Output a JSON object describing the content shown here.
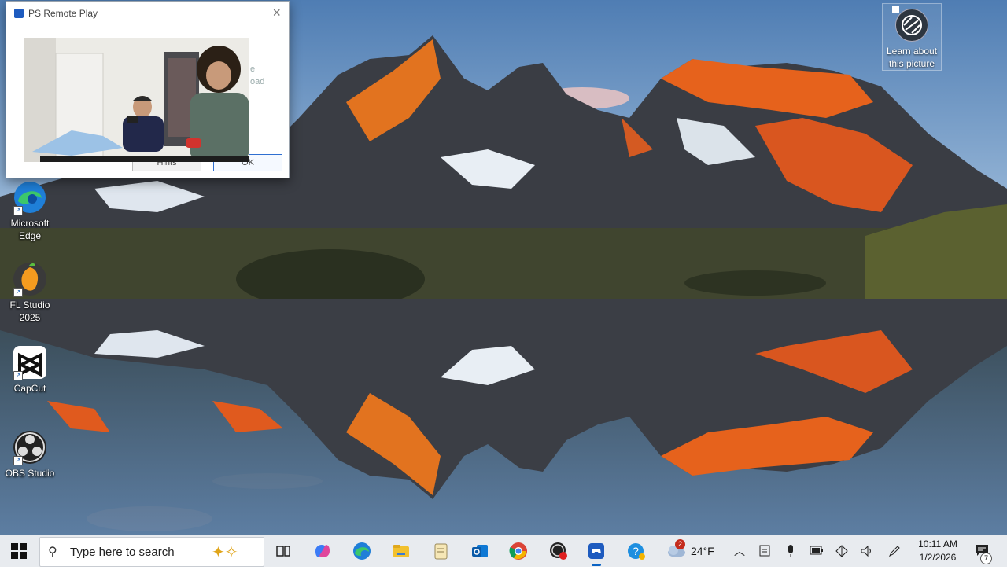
{
  "dialog": {
    "title": "PS Remote Play",
    "bg_text_1": "e",
    "bg_text_2": "oad",
    "hints_label": "Hints",
    "ok_label": "OK"
  },
  "desktop": {
    "icons": [
      {
        "label": "Microsoft Edge"
      },
      {
        "label": "FL Studio 2025"
      },
      {
        "label": "CapCut"
      },
      {
        "label": "OBS Studio"
      }
    ],
    "learn_label": "Learn about this picture"
  },
  "taskbar": {
    "search_placeholder": "Type here to search",
    "apps": [
      "task-view",
      "copilot",
      "edge",
      "file-explorer",
      "notepad",
      "outlook",
      "chrome",
      "record",
      "ps-remote-play",
      "get-help"
    ],
    "weather_badge": "2",
    "temperature": "24°F",
    "time": "10:11 AM",
    "date": "1/2/2026",
    "notification_count": "7"
  },
  "colors": {
    "sky_top": "#5d86b8",
    "sky_bottom": "#d9dfe8",
    "accent": "#0b63c4",
    "taskbar": "#e8ebef"
  }
}
